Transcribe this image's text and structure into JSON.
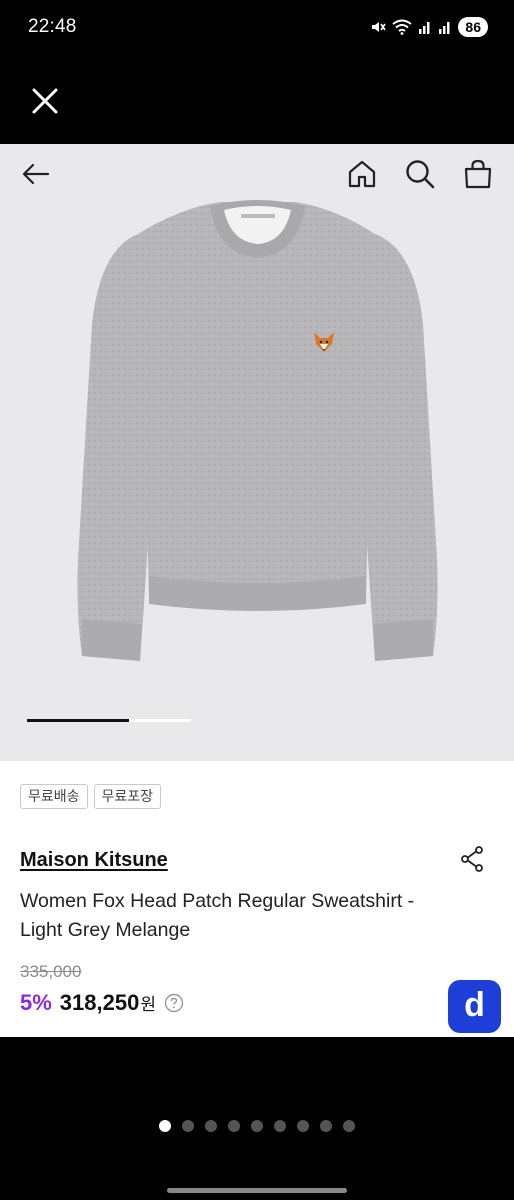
{
  "status_bar": {
    "time": "22:48",
    "battery": "86",
    "icons": [
      "mute-icon",
      "wifi-icon",
      "signal-icon",
      "signal-icon-2"
    ]
  },
  "overlay": {
    "close_icon": "close-icon"
  },
  "nav": {
    "back_icon": "arrow-left-icon",
    "home_icon": "home-icon",
    "search_icon": "search-icon",
    "cart_icon": "shopping-bag-icon"
  },
  "carousel": {
    "progress": 0.62
  },
  "tags": [
    "무료배송",
    "무료포장"
  ],
  "product": {
    "brand": "Maison Kitsune",
    "title": "Women Fox Head Patch Regular Sweatshirt - Light Grey Melange",
    "original_price": "335,000",
    "discount": "5%",
    "price": "318,250",
    "currency": "원"
  },
  "app_button": {
    "label": "d",
    "color": "#1d3fd8"
  },
  "colors": {
    "discount": "#8a2be2",
    "image_bg": "#e9e9ec"
  },
  "pager": {
    "count": 9,
    "active": 0
  }
}
